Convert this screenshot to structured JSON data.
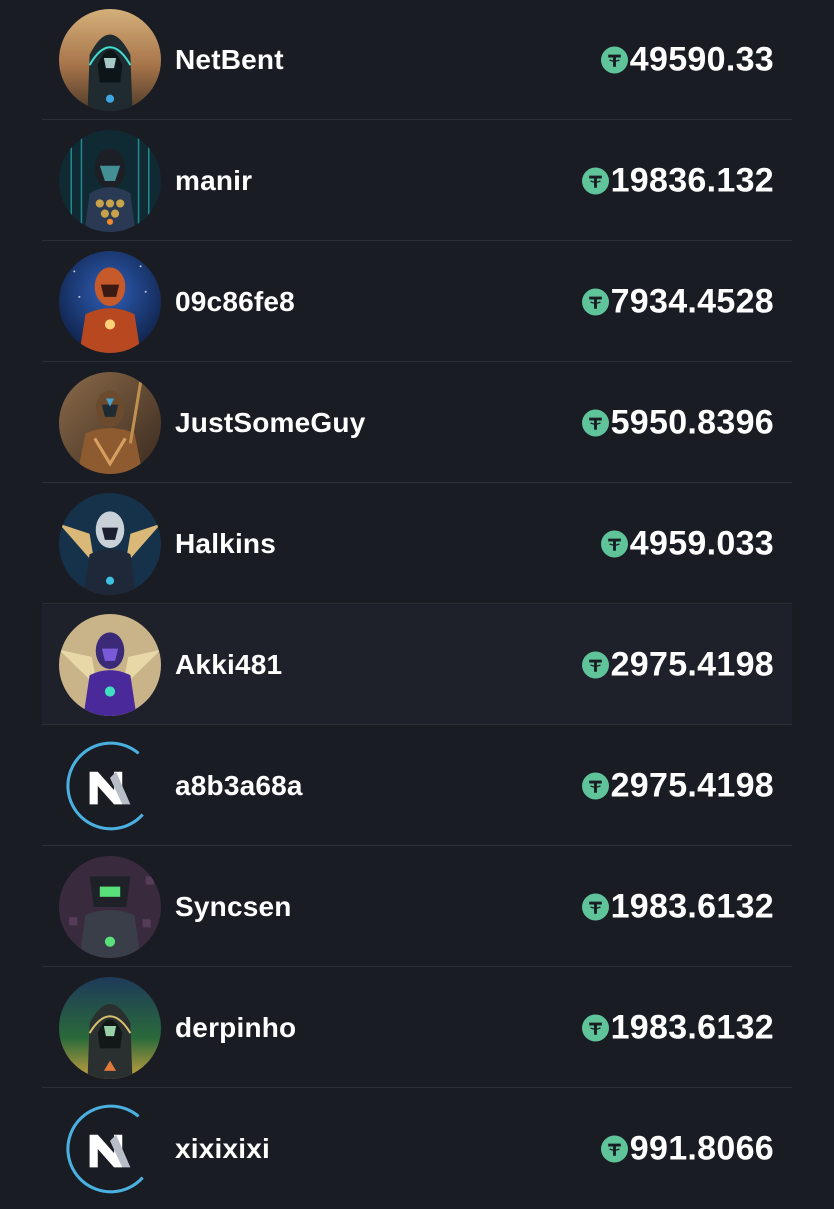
{
  "colors": {
    "background": "#1a1c24",
    "divider": "#2c2e38",
    "highlight_row": "#1f212a",
    "coin": "#5fc49a",
    "text": "#ffffff"
  },
  "coin_icon": "tether-coin-icon",
  "rows": [
    {
      "name": "NetBent",
      "amount": "49590.33",
      "avatar": "hooded-figure-avatar",
      "highlight": false
    },
    {
      "name": "manir",
      "amount": "19836.132",
      "avatar": "cyber-helmet-avatar",
      "highlight": false
    },
    {
      "name": "09c86fe8",
      "amount": "7934.4528",
      "avatar": "red-armor-avatar",
      "highlight": false
    },
    {
      "name": "JustSomeGuy",
      "amount": "5950.8396",
      "avatar": "bronze-warrior-avatar",
      "highlight": false
    },
    {
      "name": "Halkins",
      "amount": "4959.033",
      "avatar": "winged-knight-avatar",
      "highlight": false
    },
    {
      "name": "Akki481",
      "amount": "2975.4198",
      "avatar": "purple-winged-avatar",
      "highlight": true
    },
    {
      "name": "a8b3a68a",
      "amount": "2975.4198",
      "avatar": "nx-logo-avatar",
      "highlight": false
    },
    {
      "name": "Syncsen",
      "amount": "1983.6132",
      "avatar": "green-visor-avatar",
      "highlight": false
    },
    {
      "name": "derpinho",
      "amount": "1983.6132",
      "avatar": "hooded-landscape-avatar",
      "highlight": false
    },
    {
      "name": "xixixixi",
      "amount": "991.8066",
      "avatar": "nx-logo-avatar",
      "highlight": false
    }
  ]
}
